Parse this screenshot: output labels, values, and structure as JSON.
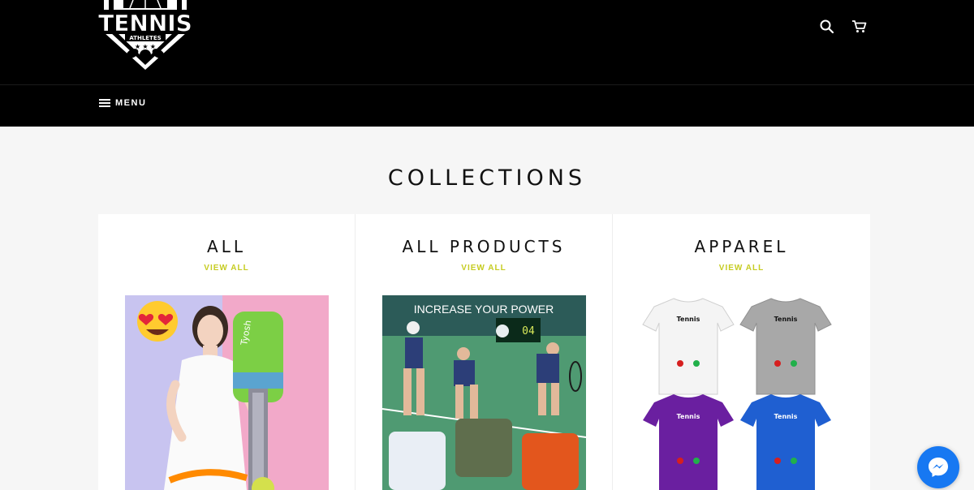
{
  "header": {
    "logo_alt": "TENNIS ATHLETES",
    "logo_word": "TENNIS",
    "logo_sub": "ATHLETES",
    "icons": [
      "search-icon",
      "cart-icon"
    ]
  },
  "nav": {
    "menu_label": "MENU",
    "menu_icon": "hamburger-icon"
  },
  "page": {
    "title": "COLLECTIONS"
  },
  "collections": [
    {
      "title": "ALL",
      "link_label": "VIEW ALL",
      "image_alt": "woman holding green tennis ball collector"
    },
    {
      "title": "ALL PRODUCTS",
      "link_label": "VIEW ALL",
      "image_alt": "tennis players on court",
      "image_caption": "INCREASE YOUR POWER"
    },
    {
      "title": "APPAREL",
      "link_label": "VIEW ALL",
      "image_alt": "tennis is calling t-shirts",
      "shirt_text": "Tennis"
    }
  ],
  "colors": {
    "header_bg": "#000000",
    "page_bg": "#f6f6f6",
    "link_accent": "#c6cc22",
    "messenger_blue": "#1778f2"
  },
  "widgets": {
    "messenger_icon": "messenger-icon"
  }
}
